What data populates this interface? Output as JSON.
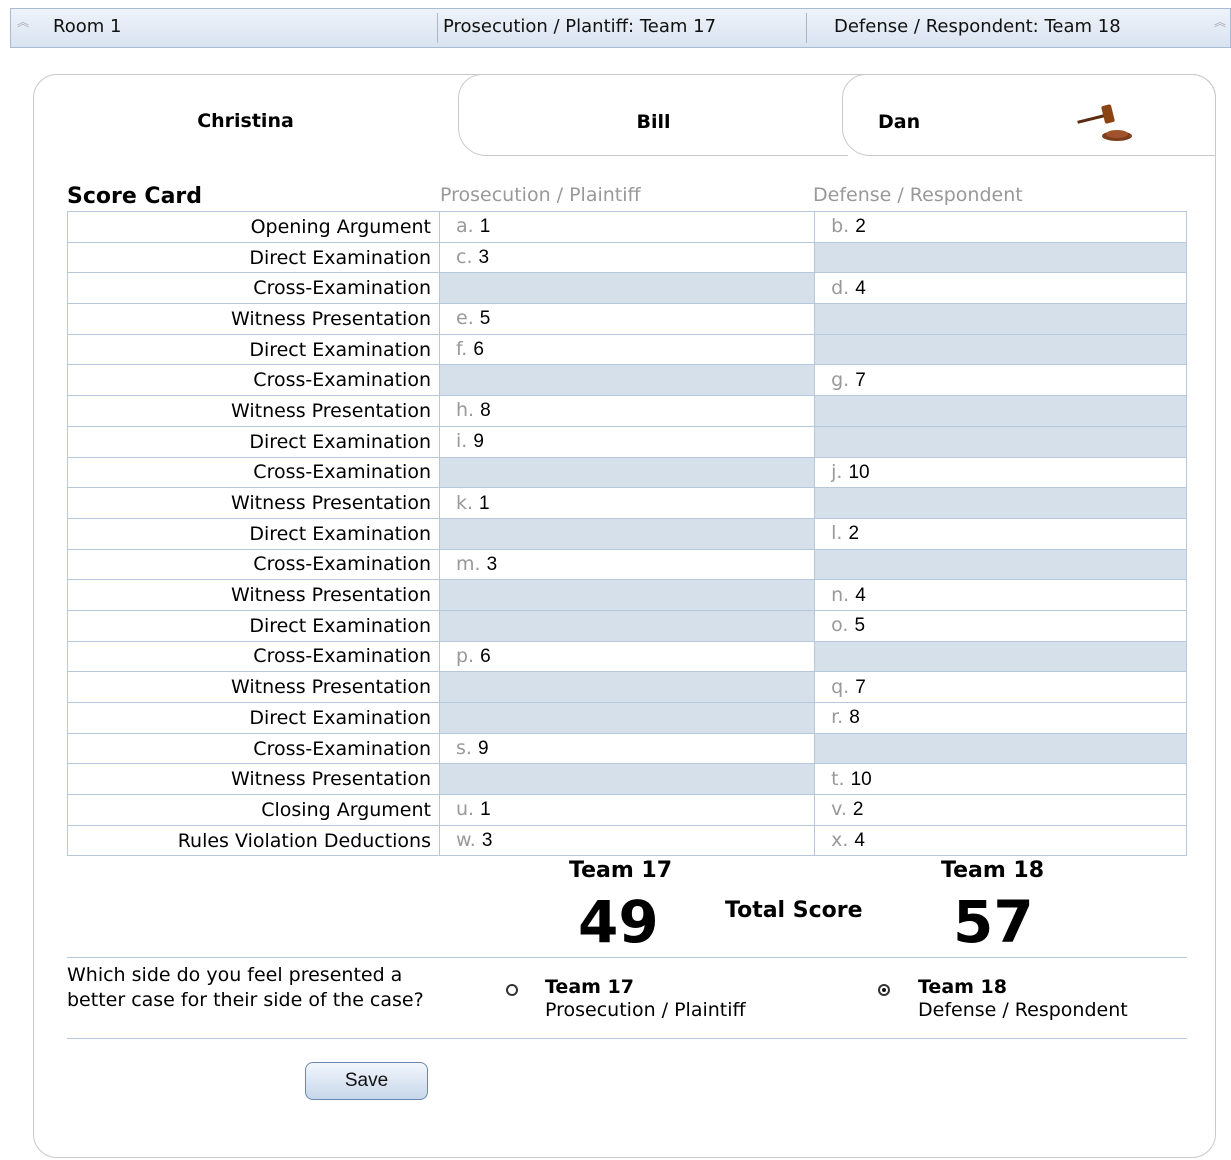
{
  "header": {
    "room": "Room 1",
    "prosecution": "Prosecution / Plantiff: Team 17",
    "defense": "Defense / Respondent: Team 18"
  },
  "tabs": [
    {
      "label": "Christina",
      "active": true
    },
    {
      "label": "Bill",
      "active": false
    },
    {
      "label": "Dan",
      "active": false
    }
  ],
  "scorecard": {
    "title": "Score Card",
    "col_prosecution": "Prosecution / Plaintiff",
    "col_defense": "Defense / Respondent",
    "rows": [
      {
        "label": "Opening Argument",
        "p_letter": "a.",
        "p_value": "1",
        "d_letter": "b.",
        "d_value": "2"
      },
      {
        "label": "Direct Examination",
        "p_letter": "c.",
        "p_value": "3",
        "d_letter": "",
        "d_value": ""
      },
      {
        "label": "Cross-Examination",
        "p_letter": "",
        "p_value": "",
        "d_letter": "d.",
        "d_value": "4"
      },
      {
        "label": "Witness Presentation",
        "p_letter": "e.",
        "p_value": "5",
        "d_letter": "",
        "d_value": ""
      },
      {
        "label": "Direct Examination",
        "p_letter": "f.",
        "p_value": "6",
        "d_letter": "",
        "d_value": ""
      },
      {
        "label": "Cross-Examination",
        "p_letter": "",
        "p_value": "",
        "d_letter": "g.",
        "d_value": "7"
      },
      {
        "label": "Witness Presentation",
        "p_letter": "h.",
        "p_value": "8",
        "d_letter": "",
        "d_value": ""
      },
      {
        "label": "Direct Examination",
        "p_letter": "i.",
        "p_value": "9",
        "d_letter": "",
        "d_value": ""
      },
      {
        "label": "Cross-Examination",
        "p_letter": "",
        "p_value": "",
        "d_letter": "j.",
        "d_value": "10"
      },
      {
        "label": "Witness Presentation",
        "p_letter": "k.",
        "p_value": "1",
        "d_letter": "",
        "d_value": ""
      },
      {
        "label": "Direct Examination",
        "p_letter": "",
        "p_value": "",
        "d_letter": "l.",
        "d_value": "2"
      },
      {
        "label": "Cross-Examination",
        "p_letter": "m.",
        "p_value": "3",
        "d_letter": "",
        "d_value": ""
      },
      {
        "label": "Witness Presentation",
        "p_letter": "",
        "p_value": "",
        "d_letter": "n.",
        "d_value": "4"
      },
      {
        "label": "Direct Examination",
        "p_letter": "",
        "p_value": "",
        "d_letter": "o.",
        "d_value": "5"
      },
      {
        "label": "Cross-Examination",
        "p_letter": "p.",
        "p_value": "6",
        "d_letter": "",
        "d_value": ""
      },
      {
        "label": "Witness Presentation",
        "p_letter": "",
        "p_value": "",
        "d_letter": "q.",
        "d_value": "7"
      },
      {
        "label": "Direct Examination",
        "p_letter": "",
        "p_value": "",
        "d_letter": "r.",
        "d_value": "8"
      },
      {
        "label": "Cross-Examination",
        "p_letter": "s.",
        "p_value": "9",
        "d_letter": "",
        "d_value": ""
      },
      {
        "label": "Witness Presentation",
        "p_letter": "",
        "p_value": "",
        "d_letter": "t.",
        "d_value": "10"
      },
      {
        "label": "Closing Argument",
        "p_letter": "u.",
        "p_value": "1",
        "d_letter": "v.",
        "d_value": "2"
      },
      {
        "label": "Rules Violation Deductions",
        "p_letter": "w.",
        "p_value": "3",
        "d_letter": "x.",
        "d_value": "4"
      }
    ]
  },
  "totals": {
    "team_p": "Team 17",
    "team_d": "Team 18",
    "label": "Total Score",
    "score_p": "49",
    "score_d": "57"
  },
  "question": {
    "text": "Which side do you feel presented a better case for their side of the case?",
    "options": [
      {
        "team": "Team 17",
        "side": "Prosecution / Plaintiff",
        "selected": false
      },
      {
        "team": "Team 18",
        "side": "Defense / Respondent",
        "selected": true
      }
    ]
  },
  "save_label": "Save",
  "colors": {
    "accent": "#d6e0eb",
    "border": "#b7c7dc"
  },
  "icons": {
    "tab_icon": "gavel-icon",
    "header_icon": "double-chevron-up-icon"
  }
}
